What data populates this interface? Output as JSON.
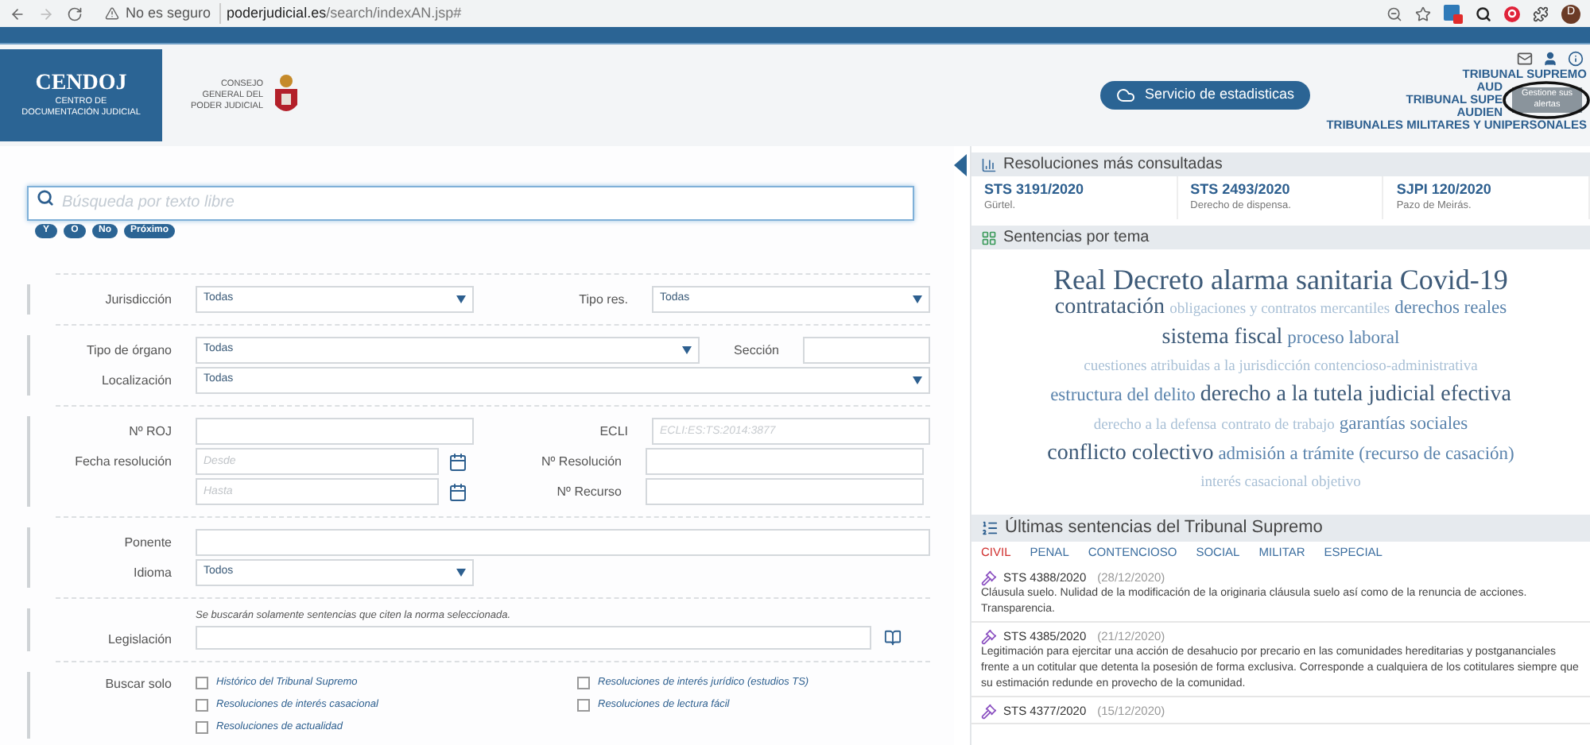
{
  "browser": {
    "warning": "No es seguro",
    "url_host": "poderjudicial.es",
    "url_path": "/search/indexAN.jsp#",
    "avatar": "D"
  },
  "header": {
    "logo": {
      "title": "CENDOJ",
      "subtitle": [
        "CENTRO DE",
        "DOCUMENTACIÓN JUDICIAL"
      ]
    },
    "council": [
      "CONSEJO",
      "GENERAL DEL",
      "PODER JUDICIAL"
    ],
    "stats_button": "Servicio de estadisticas",
    "court_links": [
      "TRIBUNAL SUPREMO",
      "AUD",
      "TRIBUNAL SUPE",
      "AUDIEN",
      "TRIBUNALES MILITARES Y UNIPERSONALES"
    ],
    "tooltip": "Gestione sus alertas"
  },
  "search": {
    "placeholder": "Búsqueda por texto libre",
    "operators": [
      "Y",
      "O",
      "No",
      "Próximo"
    ]
  },
  "sections": [
    {
      "rows": [
        [
          {
            "label": "Jurisdicción",
            "kind": "select",
            "value": "Todas"
          },
          {
            "label": "Tipo res.",
            "kind": "select",
            "value": "Todas"
          }
        ]
      ]
    },
    {
      "rows": [
        [
          {
            "label": "Tipo de órgano",
            "kind": "select",
            "value": "Todas"
          },
          {
            "label": "Sección",
            "kind": "text"
          }
        ],
        [
          {
            "label": "Localización",
            "kind": "select",
            "value": "Todas"
          }
        ]
      ]
    },
    {
      "rows": [
        [
          {
            "label": "Nº ROJ",
            "kind": "text"
          },
          {
            "label": "ECLI",
            "kind": "text",
            "placeholder": "ECLI:ES:TS:2014:3877"
          }
        ],
        [
          {
            "label": "Fecha resolución",
            "kind": "date",
            "placeholder": "Desde"
          },
          {
            "label": "Nº Resolución",
            "kind": "text"
          }
        ],
        [
          {
            "kind": "date",
            "placeholder": "Hasta"
          },
          {
            "label": "Nº Recurso",
            "kind": "text"
          }
        ]
      ]
    },
    {
      "rows": [
        [
          {
            "label": "Ponente",
            "kind": "text"
          }
        ],
        [
          {
            "label": "Idioma",
            "kind": "select",
            "value": "Todos"
          }
        ]
      ]
    }
  ],
  "legislation": {
    "label": "Legislación",
    "hint": "Se buscarán solamente sentencias que citen la norma seleccionada."
  },
  "search_only": {
    "label": "Buscar solo",
    "columns": [
      [
        {
          "label": "Histórico del Tribunal Supremo",
          "checked": false
        },
        {
          "label": "Resoluciones de interés casacional",
          "checked": false
        },
        {
          "label": "Resoluciones de actualidad",
          "checked": false
        }
      ],
      [
        {
          "label": "Resoluciones de interés jurídico (estudios TS)",
          "checked": false
        },
        {
          "label": "Resoluciones de lectura fácil",
          "checked": false
        }
      ]
    ]
  },
  "most_consulted": {
    "title": "Resoluciones más consultadas",
    "items": [
      {
        "ref": "STS 3191/2020",
        "topic": "Gürtel."
      },
      {
        "ref": "STS 2493/2020",
        "topic": "Derecho de dispensa."
      },
      {
        "ref": "SJPI 120/2020",
        "topic": "Pazo de Meirás."
      }
    ]
  },
  "topics": {
    "title": "Sentencias por tema",
    "lines": [
      [
        {
          "text": "Real Decreto alarma sanitaria Covid-19",
          "kind": "xl"
        }
      ],
      [
        {
          "text": "contratación",
          "kind": "lg"
        },
        {
          "text": "obligaciones y contratos mercantiles",
          "kind": "sm"
        },
        {
          "text": "derechos reales",
          "kind": "md"
        }
      ],
      [
        {
          "text": "sistema fiscal",
          "kind": "lg"
        },
        {
          "text": "proceso laboral",
          "kind": "md"
        }
      ],
      [
        {
          "text": "cuestiones atribuidas a la jurisdicción contencioso-administrativa",
          "kind": "sm"
        }
      ],
      [
        {
          "text": "estructura del delito",
          "kind": "md"
        },
        {
          "text": "derecho a la tutela judicial efectiva",
          "kind": "lg"
        }
      ],
      [
        {
          "text": "derecho a la defensa",
          "kind": "sm"
        },
        {
          "text": "contrato de trabajo",
          "kind": "sm"
        },
        {
          "text": "garantías sociales",
          "kind": "md"
        }
      ],
      [
        {
          "text": "conflicto colectivo",
          "kind": "lg"
        },
        {
          "text": "admisión a trámite (recurso de casación)",
          "kind": "md"
        }
      ],
      [
        {
          "text": "interés casacional objetivo",
          "kind": "sm"
        }
      ]
    ]
  },
  "latest": {
    "title": "Últimas sentencias del Tribunal Supremo",
    "tabs": [
      {
        "label": "CIVIL",
        "selected": true
      },
      {
        "label": "PENAL",
        "selected": false
      },
      {
        "label": "CONTENCIOSO",
        "selected": false
      },
      {
        "label": "SOCIAL",
        "selected": false
      },
      {
        "label": "MILITAR",
        "selected": false
      },
      {
        "label": "ESPECIAL",
        "selected": false
      }
    ],
    "items": [
      {
        "ref": "STS 4388/2020",
        "date": "(28/12/2020)",
        "summary": "Cláusula suelo. Nulidad de la modificación de la originaria cláusula suelo así como de la renuncia de acciones. Transparencia."
      },
      {
        "ref": "STS 4385/2020",
        "date": "(21/12/2020)",
        "summary": "Legitimación para ejercitar una acción de desahucio por precario en las comunidades hereditarias y postgananciales frente a un cotitular que detenta la posesión de forma exclusiva. Corresponde a cualquiera de los cotitulares siempre que su estimación redunde en provecho de la comunidad."
      },
      {
        "ref": "STS 4377/2020",
        "date": "(15/12/2020)"
      }
    ]
  }
}
